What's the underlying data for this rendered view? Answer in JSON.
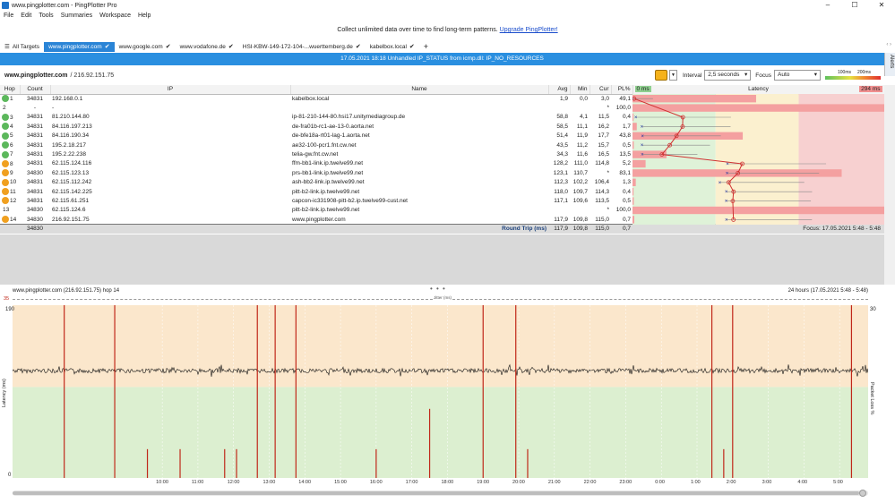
{
  "window": {
    "title": "www.pingplotter.com - PingPlotter Pro",
    "buttons": [
      "–",
      "☐",
      "✕"
    ]
  },
  "menu": [
    "File",
    "Edit",
    "Tools",
    "Summaries",
    "Workspace",
    "Help"
  ],
  "promo": {
    "text": "Collect unlimited data over time to find long-term patterns.",
    "link": "Upgrade PingPlotter!"
  },
  "tabs": [
    {
      "label": "All Targets",
      "active": false,
      "check": ""
    },
    {
      "label": "www.pingplotter.com",
      "active": true,
      "check": "✔"
    },
    {
      "label": "www.google.com",
      "active": false,
      "check": "✔"
    },
    {
      "label": "www.vodafone.de",
      "active": false,
      "check": "✔"
    },
    {
      "label": "HSI-KBW-149-172-104-...wuerttemberg.de",
      "active": false,
      "check": "✔"
    },
    {
      "label": "kabelbox.local",
      "active": false,
      "check": "✔"
    }
  ],
  "error_banner": "17.05.2021 18:18 Unhandled IP_STATUS from icmp.dll: IP_NO_RESOURCES",
  "alerts_label": "Alerts",
  "target": {
    "name": "www.pingplotter.com",
    "ip": "/ 216.92.151.75"
  },
  "controls": {
    "interval_label": "Interval",
    "interval_value": "2,5 seconds",
    "focus_label": "Focus",
    "focus_value": "Auto",
    "legend_100": "100ms",
    "legend_200": "200ms"
  },
  "columns": {
    "hop": "Hop",
    "count": "Count",
    "ip": "IP",
    "name": "Name",
    "avg": "Avg",
    "min": "Min",
    "cur": "Cur",
    "pl": "PL%",
    "latency": "Latency",
    "lat_min": "0 ms",
    "lat_max": "294 ms"
  },
  "hops": [
    {
      "hop": "1",
      "count": "34831",
      "ip": "192.168.0.1",
      "name": "kabelbox.local",
      "avg": "1,9",
      "min": "0,0",
      "cur": "3,0",
      "pl": "49,1",
      "color": "green"
    },
    {
      "hop": "2",
      "count": "-",
      "ip": "-",
      "name": "",
      "avg": "",
      "min": "",
      "cur": "*",
      "pl": "100,0",
      "color": "grey"
    },
    {
      "hop": "3",
      "count": "34831",
      "ip": "81.210.144.80",
      "name": "ip-81-210-144-80.hsi17.unitymediagroup.de",
      "avg": "58,8",
      "min": "4,1",
      "cur": "11,5",
      "pl": "0,4",
      "color": "green"
    },
    {
      "hop": "4",
      "count": "34831",
      "ip": "84.116.197.213",
      "name": "de-fra01b-rc1-ae-13-0.aorta.net",
      "avg": "58,5",
      "min": "11,1",
      "cur": "16,2",
      "pl": "1,7",
      "color": "green"
    },
    {
      "hop": "5",
      "count": "34831",
      "ip": "84.116.190.34",
      "name": "de-bfe18a-rt01-lag-1.aorta.net",
      "avg": "51,4",
      "min": "11,9",
      "cur": "17,7",
      "pl": "43,8",
      "color": "green"
    },
    {
      "hop": "6",
      "count": "34831",
      "ip": "195.2.18.217",
      "name": "ae32-100-pcr1.fnt.cw.net",
      "avg": "43,5",
      "min": "11,2",
      "cur": "15,7",
      "pl": "0,5",
      "color": "green"
    },
    {
      "hop": "7",
      "count": "34831",
      "ip": "195.2.22.238",
      "name": "telia-gw.fnt.cw.net",
      "avg": "34,3",
      "min": "11,6",
      "cur": "16,5",
      "pl": "13,5",
      "color": "green"
    },
    {
      "hop": "8",
      "count": "34831",
      "ip": "62.115.124.116",
      "name": "ffm-bb1-link.ip.twelve99.net",
      "avg": "128,2",
      "min": "111,0",
      "cur": "114,8",
      "pl": "5,2",
      "color": "orange"
    },
    {
      "hop": "9",
      "count": "34830",
      "ip": "62.115.123.13",
      "name": "prs-bb1-link.ip.twelve99.net",
      "avg": "123,1",
      "min": "110,7",
      "cur": "*",
      "pl": "83,1",
      "color": "orange"
    },
    {
      "hop": "10",
      "count": "34831",
      "ip": "62.115.112.242",
      "name": "ash-bb2-link.ip.twelve99.net",
      "avg": "112,3",
      "min": "102,2",
      "cur": "106,4",
      "pl": "1,3",
      "color": "orange"
    },
    {
      "hop": "11",
      "count": "34831",
      "ip": "62.115.142.225",
      "name": "pitt-b2-link.ip.twelve99.net",
      "avg": "118,0",
      "min": "109,7",
      "cur": "114,3",
      "pl": "0,4",
      "color": "orange"
    },
    {
      "hop": "12",
      "count": "34831",
      "ip": "62.115.61.251",
      "name": "capcon-ic331908-pitt-b2.ip.twelve99-cust.net",
      "avg": "117,1",
      "min": "109,6",
      "cur": "113,5",
      "pl": "0,5",
      "color": "orange"
    },
    {
      "hop": "13",
      "count": "34830",
      "ip": "62.115.124.6",
      "name": "pitt-b2-link.ip.twelve99.net",
      "avg": "",
      "min": "",
      "cur": "*",
      "pl": "100,0",
      "color": "grey"
    },
    {
      "hop": "14",
      "count": "34830",
      "ip": "216.92.151.75",
      "name": "www.pingplotter.com",
      "avg": "117,9",
      "min": "109,8",
      "cur": "115,0",
      "pl": "0,7",
      "color": "orange"
    }
  ],
  "summary": {
    "count": "34830",
    "label": "Round Trip (ms)",
    "avg": "117,9",
    "min": "109,8",
    "cur": "115,0",
    "pl": "0,7",
    "focus": "Focus: 17.05.2021 5:48 - 5:48"
  },
  "graph": {
    "title": "www.pingplotter.com (216.92.151.75) hop 14",
    "range": "24 hours (17.05.2021 5:48 - 5:48)",
    "jitter_label": "Jitter (ms)",
    "jitter_max": "35",
    "y_max": "190",
    "y_min": "0",
    "pl_max": "30",
    "y_label": "Latency (ms)",
    "pl_label": "Packet Loss %",
    "x_labels": [
      "10:00",
      "11:00",
      "12:00",
      "13:00",
      "14:00",
      "15:00",
      "16:00",
      "17:00",
      "18:00",
      "19:00",
      "20:00",
      "21:00",
      "22:00",
      "23:00",
      "0:00",
      "1:00",
      "2:00",
      "3:00",
      "4:00",
      "5:00"
    ]
  },
  "chart_data": {
    "type": "line",
    "ylim": [
      0,
      190
    ],
    "pl_ylim": [
      0,
      30
    ],
    "latency_baseline": 117.9,
    "packet_loss_events": [
      {
        "t": "7:15",
        "pl": 30
      },
      {
        "t": "8:40",
        "pl": 30
      },
      {
        "t": "9:35",
        "pl": 5
      },
      {
        "t": "10:30",
        "pl": 5
      },
      {
        "t": "11:45",
        "pl": 5
      },
      {
        "t": "12:05",
        "pl": 5
      },
      {
        "t": "12:40",
        "pl": 30
      },
      {
        "t": "13:10",
        "pl": 30
      },
      {
        "t": "13:45",
        "pl": 30
      },
      {
        "t": "16:00",
        "pl": 5
      },
      {
        "t": "17:30",
        "pl": 12
      },
      {
        "t": "19:00",
        "pl": 30
      },
      {
        "t": "19:55",
        "pl": 30
      },
      {
        "t": "20:15",
        "pl": 5
      },
      {
        "t": "1:25",
        "pl": 30
      },
      {
        "t": "1:45",
        "pl": 5
      },
      {
        "t": "2:00",
        "pl": 30
      },
      {
        "t": "5:20",
        "pl": 30
      }
    ]
  },
  "colors": {
    "green": "#5cb85c",
    "orange": "#f0a020",
    "accent": "#2a84d6",
    "pl": "#c0281a"
  }
}
